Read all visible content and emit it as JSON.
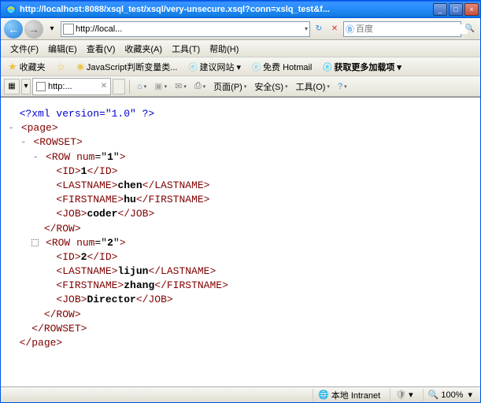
{
  "window": {
    "title": "http://localhost:8088/xsql_test/xsql/very-unsecure.xsql?conn=xslq_test&f..."
  },
  "address": {
    "value": "http://local..."
  },
  "search": {
    "placeholder": "百度"
  },
  "menu": {
    "file": "文件(F)",
    "edit": "编辑(E)",
    "view": "查看(V)",
    "favorites": "收藏夹(A)",
    "tools": "工具(T)",
    "help": "帮助(H)"
  },
  "favorites": {
    "label": "收藏夹",
    "items": [
      "JavaScript判断变量类...",
      "建议网站 ▾",
      "免费 Hotmail",
      "获取更多加载项 ▾"
    ]
  },
  "tabs": {
    "active": "http:..."
  },
  "toolbar": {
    "page": "页面(P)",
    "safety": "安全(S)",
    "tools": "工具(O)"
  },
  "xml": {
    "decl": "<?xml version=\"1.0\" ?>",
    "rows": [
      {
        "num": "1",
        "id": "1",
        "lastname": "chen",
        "firstname": "hu",
        "job": "coder"
      },
      {
        "num": "2",
        "id": "2",
        "lastname": "lijun",
        "firstname": "zhang",
        "job": "Director"
      }
    ]
  },
  "status": {
    "zone": "本地 Intranet",
    "zoom": "100%"
  }
}
